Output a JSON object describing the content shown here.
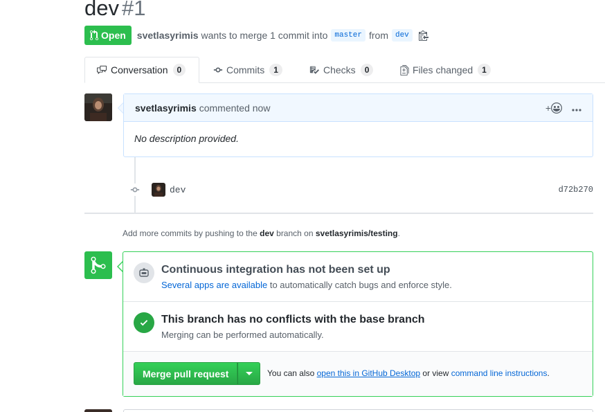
{
  "pr": {
    "title": "dev",
    "number": "#1",
    "state": "Open",
    "author": "svetlasyrimis",
    "merge_text": "wants to merge 1 commit into",
    "base_branch": "master",
    "from_text": "from",
    "head_branch": "dev"
  },
  "tabs": [
    {
      "label": "Conversation",
      "count": "0"
    },
    {
      "label": "Commits",
      "count": "1"
    },
    {
      "label": "Checks",
      "count": "0"
    },
    {
      "label": "Files changed",
      "count": "1"
    }
  ],
  "comment": {
    "author": "svetlasyrimis",
    "action": "commented now",
    "reaction_label": "+",
    "body": "No description provided."
  },
  "commit": {
    "message": "dev",
    "sha": "d72b270"
  },
  "hint": {
    "prefix": "Add more commits by pushing to the",
    "branch": "dev",
    "middle": "branch on",
    "repo": "svetlasyrimis/testing",
    "suffix": "."
  },
  "merge_box": {
    "ci_title": "Continuous integration has not been set up",
    "ci_link": "Several apps are available",
    "ci_suffix": "to automatically catch bugs and enforce style.",
    "conflict_title": "This branch has no conflicts with the base branch",
    "conflict_sub": "Merging can be performed automatically.",
    "merge_button": "Merge pull request",
    "note_prefix": "You can also",
    "note_link1": "open this in GitHub Desktop",
    "note_middle": "or view",
    "note_link2": "command line instructions",
    "note_suffix": "."
  },
  "colors": {
    "green": "#2cbe4e",
    "link": "#0366d6",
    "comment_border": "#c8e1ff",
    "comment_header": "#f1f8ff"
  }
}
